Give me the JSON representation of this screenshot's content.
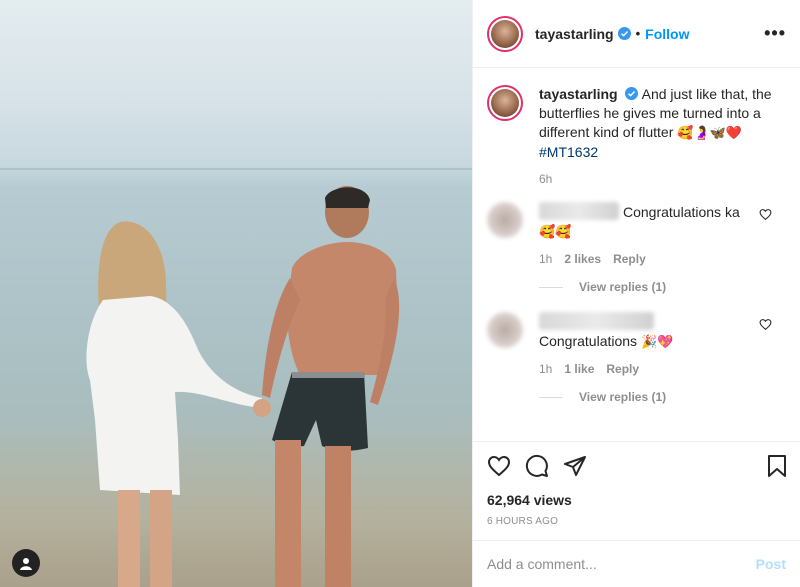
{
  "post": {
    "image": {
      "description_icon": "photo-couple-beach"
    },
    "profile_badge_icon": "user-tag-icon"
  },
  "header": {
    "username": "tayastarling",
    "separator": "•",
    "follow_label": "Follow",
    "more_label": "•••"
  },
  "caption": {
    "username": "tayastarling",
    "text": "And just like that, the butterflies he gives me turned into a different kind of flutter",
    "emojis": "🥰🤰🦋❤️",
    "hashtag": "#MT1632",
    "time": "6h"
  },
  "comments": [
    {
      "text": "Congratulations ka",
      "emojis": "🥰🥰",
      "time": "1h",
      "likes": "2 likes",
      "reply": "Reply",
      "view_replies": "View replies (1)"
    },
    {
      "text": "Congratulations",
      "emojis": "🎉💖",
      "time": "1h",
      "likes": "1 like",
      "reply": "Reply",
      "view_replies": "View replies (1)"
    }
  ],
  "actions": {
    "views": "62,964 views",
    "posted_ago": "6 HOURS AGO"
  },
  "add_comment": {
    "placeholder": "Add a comment...",
    "post_label": "Post"
  },
  "colors": {
    "accent": "#0095f6",
    "post_disabled": "#b2dffc",
    "text": "#262626",
    "muted": "#8e8e8e"
  }
}
